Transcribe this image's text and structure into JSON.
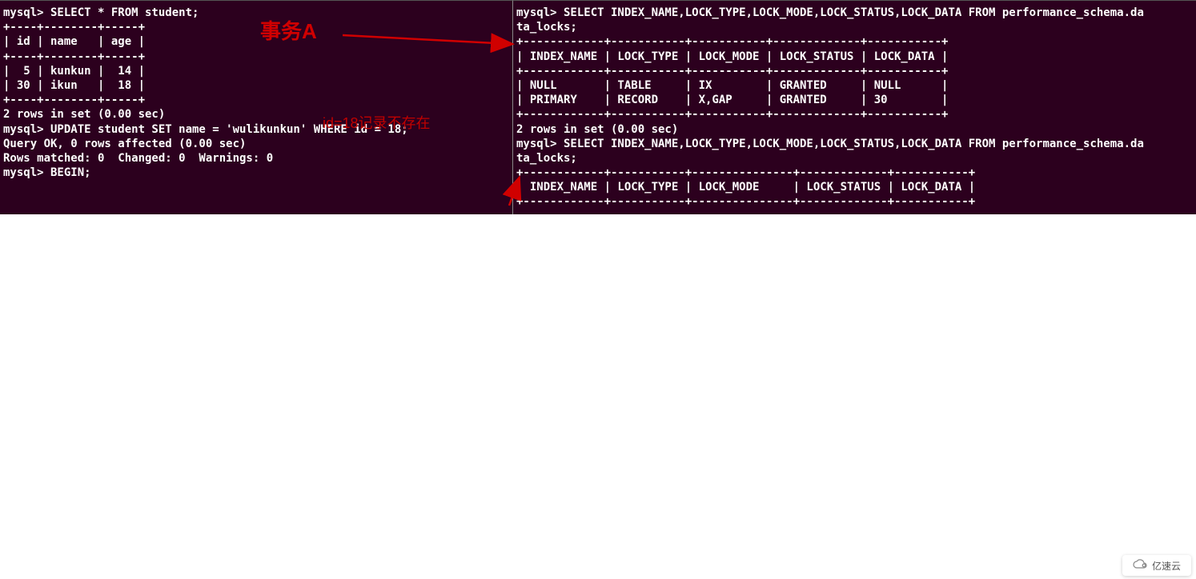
{
  "left": {
    "l1": "mysql> SELECT * FROM student;",
    "l2": "+----+--------+-----+",
    "l3": "| id | name   | age |",
    "l4": "+----+--------+-----+",
    "l5": "|  5 | kunkun |  14 |",
    "l6": "| 30 | ikun   |  18 |",
    "l7": "+----+--------+-----+",
    "l8": "2 rows in set (0.00 sec)",
    "l9": "",
    "l10": "mysql> UPDATE student SET name = 'wulikunkun' WHERE id = 18;",
    "l11": "Query OK, 0 rows affected (0.00 sec)",
    "l12": "Rows matched: 0  Changed: 0  Warnings: 0",
    "l13": "",
    "l14": "mysql> BEGIN;"
  },
  "right": {
    "r1": "mysql> SELECT INDEX_NAME,LOCK_TYPE,LOCK_MODE,LOCK_STATUS,LOCK_DATA FROM performance_schema.da",
    "r2": "ta_locks;",
    "r3": "+------------+-----------+-----------+-------------+-----------+",
    "r4": "| INDEX_NAME | LOCK_TYPE | LOCK_MODE | LOCK_STATUS | LOCK_DATA |",
    "r5": "+------------+-----------+-----------+-------------+-----------+",
    "r6": "| NULL       | TABLE     | IX        | GRANTED     | NULL      |",
    "r7": "| PRIMARY    | RECORD    | X,GAP     | GRANTED     | 30        |",
    "r8": "+------------+-----------+-----------+-------------+-----------+",
    "r9": "2 rows in set (0.00 sec)",
    "r10": "",
    "r11": "mysql> SELECT INDEX_NAME,LOCK_TYPE,LOCK_MODE,LOCK_STATUS,LOCK_DATA FROM performance_schema.da",
    "r12": "ta_locks;",
    "r13": "+------------+-----------+---------------+-------------+-----------+",
    "r14": "| INDEX_NAME | LOCK_TYPE | LOCK_MODE     | LOCK_STATUS | LOCK_DATA |",
    "r15": "+------------+-----------+---------------+-------------+-----------+"
  },
  "annotations": {
    "transaction_label": "事务A",
    "note_id18": "id=18记录不存在"
  },
  "watermark": {
    "text": "亿速云"
  },
  "tables": {
    "student_rows": [
      {
        "id": 5,
        "name": "kunkun",
        "age": 14
      },
      {
        "id": 30,
        "name": "ikun",
        "age": 18
      }
    ],
    "locks_rows": [
      {
        "INDEX_NAME": "NULL",
        "LOCK_TYPE": "TABLE",
        "LOCK_MODE": "IX",
        "LOCK_STATUS": "GRANTED",
        "LOCK_DATA": "NULL"
      },
      {
        "INDEX_NAME": "PRIMARY",
        "LOCK_TYPE": "RECORD",
        "LOCK_MODE": "X,GAP",
        "LOCK_STATUS": "GRANTED",
        "LOCK_DATA": "30"
      }
    ]
  }
}
